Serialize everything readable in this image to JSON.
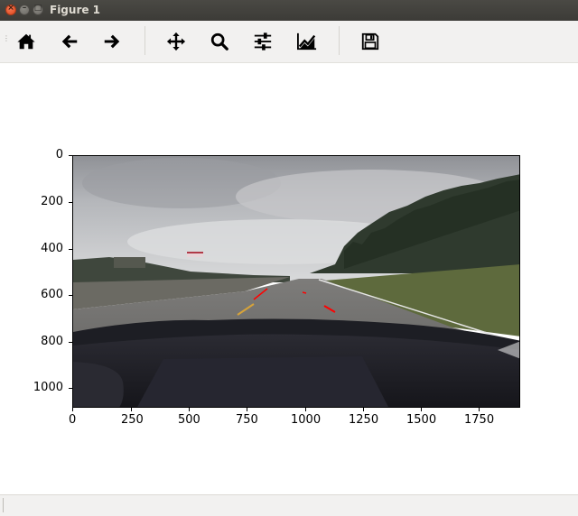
{
  "window": {
    "title": "Figure 1",
    "buttons": {
      "close": "×",
      "minimize": "–",
      "maximize": "□"
    }
  },
  "toolbar": {
    "items": [
      {
        "name": "home",
        "icon": "home-icon"
      },
      {
        "name": "back",
        "icon": "arrow-left-icon"
      },
      {
        "name": "forward",
        "icon": "arrow-right-icon"
      },
      {
        "name": "pan",
        "icon": "move-icon"
      },
      {
        "name": "zoom",
        "icon": "search-icon"
      },
      {
        "name": "subplots",
        "icon": "sliders-icon"
      },
      {
        "name": "customize",
        "icon": "line-chart-icon"
      },
      {
        "name": "save",
        "icon": "floppy-disk-icon"
      }
    ]
  },
  "plot": {
    "image_description_colors": {
      "sky": "#c9cacc",
      "road": "#707070",
      "lane_markings": "#ff0000",
      "dashboard": "#1c1c22"
    },
    "x_ticks": [
      "0",
      "250",
      "500",
      "750",
      "1000",
      "1250",
      "1500",
      "1750"
    ],
    "y_ticks": [
      "0",
      "200",
      "400",
      "600",
      "800",
      "1000"
    ],
    "xlim": [
      0,
      1920
    ],
    "ylim": [
      1080,
      0
    ]
  },
  "statusbar": {
    "text": ""
  }
}
